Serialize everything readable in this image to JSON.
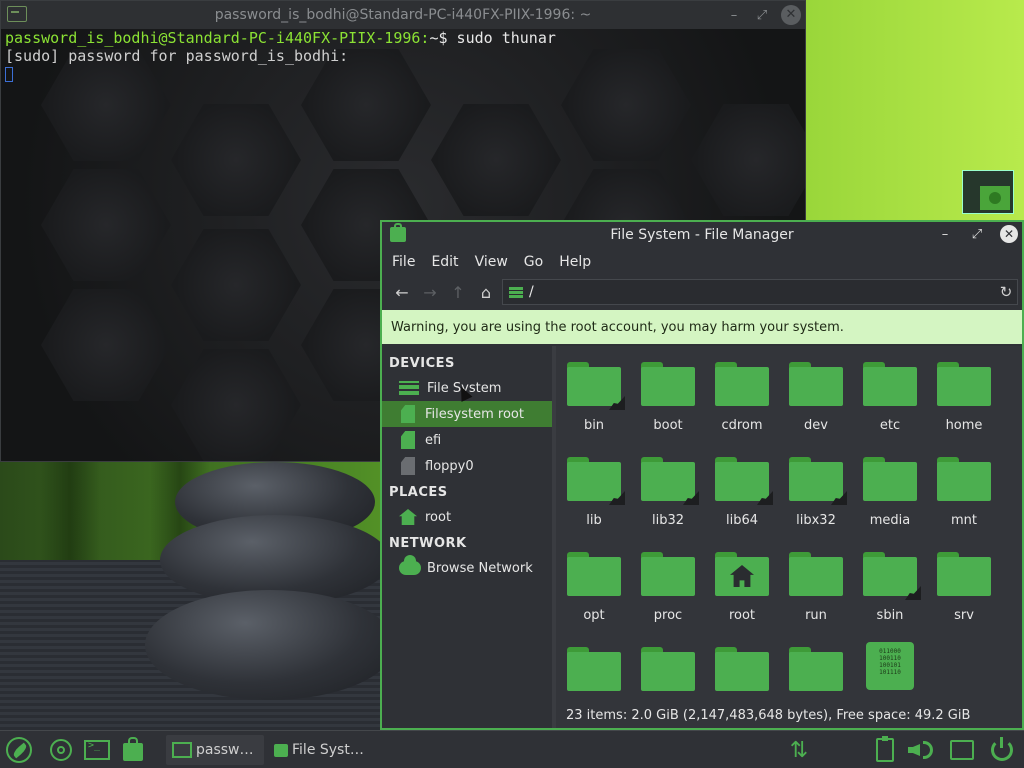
{
  "terminal": {
    "title": "password_is_bodhi@Standard-PC-i440FX-PIIX-1996: ~",
    "prompt": "password_is_bodhi@Standard-PC-i440FX-PIIX-1996:",
    "prompt_path": "~",
    "prompt_symbol": "$ ",
    "command": "sudo thunar",
    "line2": "[sudo] password for password_is_bodhi:",
    "buttons": {
      "minimize": "–",
      "restore": "⤢",
      "close": "✕"
    }
  },
  "file_manager": {
    "title": "File System - File Manager",
    "buttons": {
      "minimize": "–",
      "maximize": "⤢",
      "close": "✕"
    },
    "menu": [
      "File",
      "Edit",
      "View",
      "Go",
      "Help"
    ],
    "toolbar": {
      "back": "←",
      "forward": "→",
      "up": "↑",
      "home": "⌂",
      "reload": "↻"
    },
    "location": "/",
    "warning": "Warning, you are using the root account, you may harm your system.",
    "sidebar": {
      "devices_header": "DEVICES",
      "devices": [
        "File System",
        "Filesystem root",
        "efi",
        "floppy0"
      ],
      "places_header": "PLACES",
      "places": [
        "root"
      ],
      "network_header": "NETWORK",
      "network": [
        "Browse Network"
      ]
    },
    "files": {
      "row1": [
        "bin",
        "boot",
        "cdrom",
        "dev",
        "etc",
        "home"
      ],
      "row2": [
        "lib",
        "lib32",
        "lib64",
        "libx32",
        "media",
        "mnt"
      ],
      "row3": [
        "opt",
        "proc",
        "root",
        "run",
        "sbin",
        "srv"
      ]
    },
    "binary_glyph": "011000\n100110\n100101\n101110",
    "status": "23 items: 2.0 GiB (2,147,483,648 bytes), Free space: 49.2 GiB"
  },
  "taskbar": {
    "tasks": [
      {
        "label": "passw…"
      },
      {
        "label": "File Syst…"
      }
    ],
    "tray": {
      "network": "⇅"
    }
  },
  "colors": {
    "accent": "#4caf50",
    "warning_bg": "#d4f5c2",
    "selection": "#3f7d32",
    "prompt": "#8be234"
  }
}
